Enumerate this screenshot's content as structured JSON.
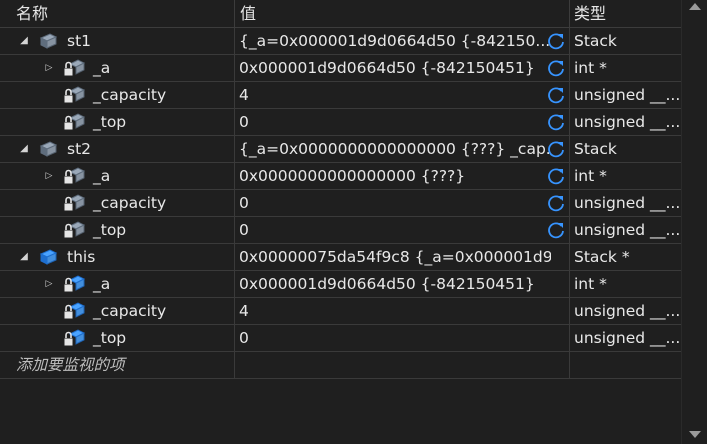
{
  "header": {
    "name": "名称",
    "value": "值",
    "type": "类型"
  },
  "rows": [
    {
      "name": "st1",
      "value": "{_a=0x000001d9d0664d50 {-842150...",
      "type": "Stack",
      "expander": "expanded",
      "icon": "object-icon",
      "refresh": true
    },
    {
      "name": "_a",
      "value": "0x000001d9d0664d50 {-842150451}",
      "type": "int *",
      "expander": "collapsed",
      "icon": "locked-field-icon",
      "refresh": true
    },
    {
      "name": "_capacity",
      "value": "4",
      "type": "unsigned __...",
      "expander": "none",
      "icon": "locked-field-icon",
      "refresh": true
    },
    {
      "name": "_top",
      "value": "0",
      "type": "unsigned __...",
      "expander": "none",
      "icon": "locked-field-icon",
      "refresh": true
    },
    {
      "name": "st2",
      "value": "{_a=0x0000000000000000 {???} _cap...",
      "type": "Stack",
      "expander": "expanded",
      "icon": "object-icon",
      "refresh": true
    },
    {
      "name": "_a",
      "value": "0x0000000000000000 {???}",
      "type": "int *",
      "expander": "collapsed",
      "icon": "locked-field-icon",
      "refresh": true
    },
    {
      "name": "_capacity",
      "value": "0",
      "type": "unsigned __...",
      "expander": "none",
      "icon": "locked-field-icon",
      "refresh": true
    },
    {
      "name": "_top",
      "value": "0",
      "type": "unsigned __...",
      "expander": "none",
      "icon": "locked-field-icon",
      "refresh": true
    },
    {
      "name": "this",
      "value": "0x00000075da54f9c8 {_a=0x000001d9...",
      "type": "Stack *",
      "expander": "expanded",
      "icon": "object-icon-blue",
      "refresh": false
    },
    {
      "name": "_a",
      "value": "0x000001d9d0664d50 {-842150451}",
      "type": "int *",
      "expander": "collapsed",
      "icon": "locked-field-icon-blue",
      "refresh": false
    },
    {
      "name": "_capacity",
      "value": "4",
      "type": "unsigned __...",
      "expander": "none",
      "icon": "locked-field-icon-blue",
      "refresh": false
    },
    {
      "name": "_top",
      "value": "0",
      "type": "unsigned __...",
      "expander": "none",
      "icon": "locked-field-icon-blue",
      "refresh": false
    }
  ],
  "add_watch": "添加要监视的项",
  "colors": {
    "background": "#1f1f1f",
    "text": "#e8e8e8",
    "refresh": "#3794ff",
    "icon_gray": "#9aa8b8",
    "icon_blue": "#4aa3ff"
  }
}
